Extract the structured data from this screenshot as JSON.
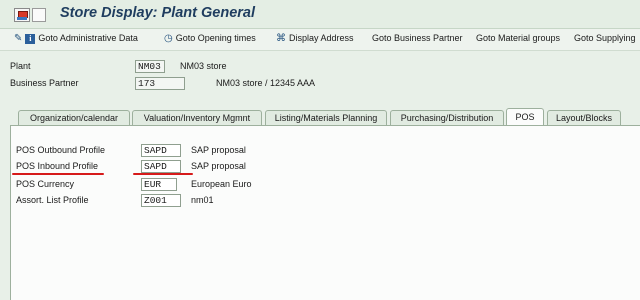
{
  "window": {
    "title": "Store Display: Plant General"
  },
  "toolbar": {
    "items": [
      {
        "label": "Goto Administrative Data",
        "icon": "info-icon"
      },
      {
        "label": "Goto Opening times",
        "icon": "clock-icon"
      },
      {
        "label": "Display Address",
        "icon": "address-icon"
      },
      {
        "label": "Goto Business Partner"
      },
      {
        "label": "Goto Material groups"
      },
      {
        "label": "Goto Supplying"
      }
    ]
  },
  "header": {
    "plant_label": "Plant",
    "plant_value": "NM03",
    "plant_desc": "NM03 store",
    "bp_label": "Business Partner",
    "bp_value": "173",
    "bp_desc": "NM03 store / 12345 AAA"
  },
  "tabs": [
    {
      "label": "Organization/calendar"
    },
    {
      "label": "Valuation/Inventory Mgmnt"
    },
    {
      "label": "Listing/Materials Planning"
    },
    {
      "label": "Purchasing/Distribution"
    },
    {
      "label": "POS",
      "active": true
    },
    {
      "label": "Layout/Blocks"
    }
  ],
  "pos": {
    "fields": [
      {
        "label": "POS Outbound Profile",
        "value": "SAPD",
        "desc": "SAP proposal"
      },
      {
        "label": "POS Inbound Profile",
        "value": "SAPD",
        "desc": "SAP proposal"
      },
      {
        "label": "POS Currency",
        "value": "EUR",
        "desc": "European Euro"
      },
      {
        "label": "Assort. List Profile",
        "value": "Z001",
        "desc": "nm01"
      }
    ]
  },
  "colors": {
    "highlight_underline": "#d61a1a",
    "title": "#1f3d5f"
  }
}
